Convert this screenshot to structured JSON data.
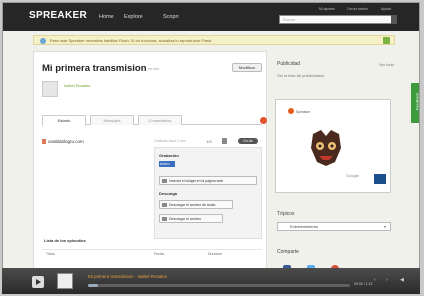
{
  "header": {
    "logo": "SPREAKER",
    "nav": [
      "Home",
      "Explore",
      "Scopri"
    ],
    "utility": [
      "Mi ajustes",
      "Cerrar sesión",
      "Ayuda"
    ],
    "search_placeholder": "Buscar"
  },
  "notice": {
    "text": "Para usar Spreaker necesitas habilitar Flash. Si no funciona, actualiza tu reproductor Flash."
  },
  "episode": {
    "title": "Mi primera transmision",
    "subtitle": "en vivo",
    "edit_label": "Modificar",
    "author": "Isabel Rosales",
    "tabs": [
      "Estado",
      "Mensajes",
      "Comentarios"
    ],
    "url": "unablablogru.com",
    "recorded": "Grabado hace 2 min",
    "count": "1/3",
    "pill_label": "On Air"
  },
  "panel": {
    "status_heading": "Grabación",
    "status_value": "Activo",
    "action_embed": "Insertar el widget en la página web",
    "media_heading": "Descarga",
    "action_download": "Descargar el archivo de audio",
    "action_download2": "Descargar el archivo"
  },
  "list": {
    "heading": "Lista de los episodios",
    "columns": [
      "Título",
      "Fecha",
      "Duración"
    ]
  },
  "sidebar": {
    "heading": "Publicidad",
    "see_all": "Ver todo",
    "link": "Ver la lista de publicidades",
    "preview_label": "Spreaker",
    "google_label": "Google",
    "topic_heading": "Tópicos",
    "topic_value": "Entretenimiento",
    "share_heading": "Comparte"
  },
  "feedback": "Feedback",
  "player": {
    "title": "Mi primera transmision · Isabel Rosales",
    "time": "00:00 / 1:12",
    "progress": 0.04
  }
}
